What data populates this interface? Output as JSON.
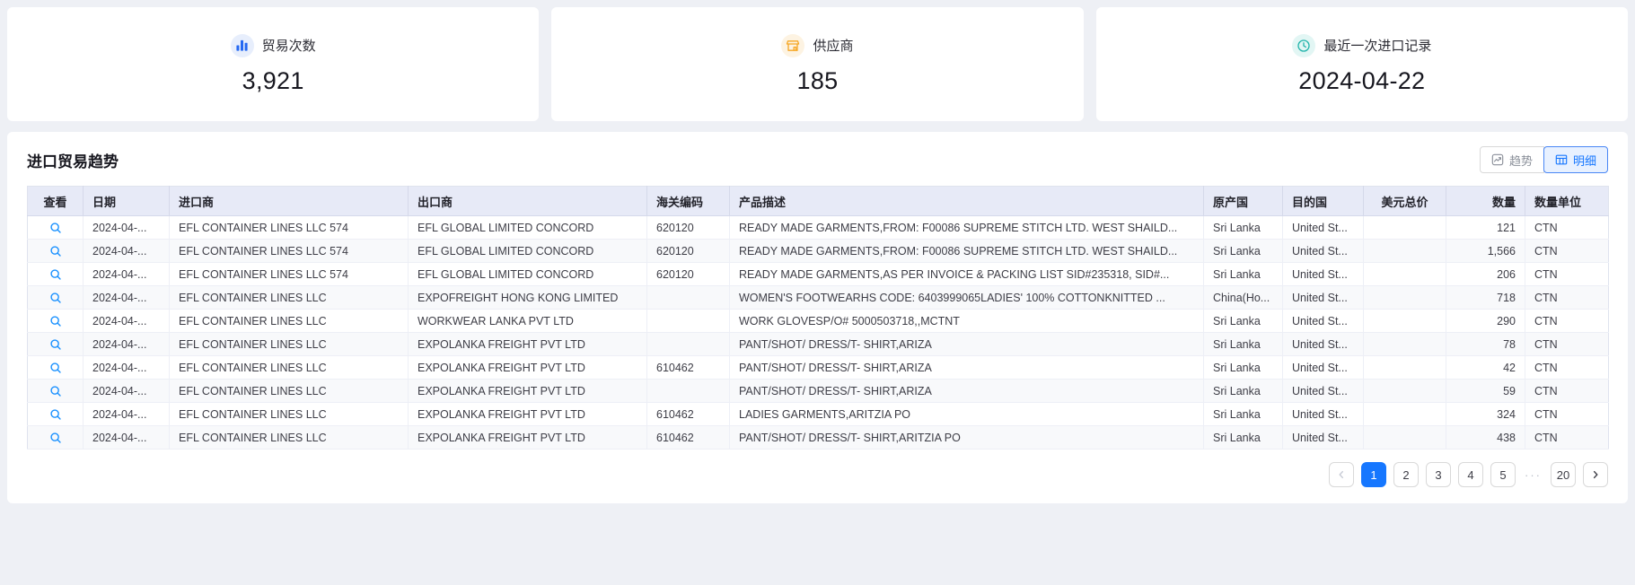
{
  "colors": {
    "page_bg": "#eef0f5",
    "accent_blue": "#1677ff",
    "table_header_bg": "#e7eaf7",
    "magnifier_blue": "#1890ff"
  },
  "cards": [
    {
      "icon": "bar-chart-icon",
      "label": "贸易次数",
      "value": "3,921",
      "icon_color": "#2468f2",
      "icon_bg": "#e7eefc"
    },
    {
      "icon": "shop-icon",
      "label": "供应商",
      "value": "185",
      "icon_color": "#f6a622",
      "icon_bg": "#fdf3e2"
    },
    {
      "icon": "clock-icon",
      "label": "最近一次进口记录",
      "value": "2024-04-22",
      "icon_color": "#1fb3aa",
      "icon_bg": "#e2f6f4"
    }
  ],
  "panel": {
    "title": "进口贸易趋势"
  },
  "toggle": {
    "trend": "趋势",
    "detail": "明细",
    "active": "明细"
  },
  "table": {
    "headers": {
      "view": "查看",
      "date": "日期",
      "importer": "进口商",
      "exporter": "出口商",
      "hs_code": "海关编码",
      "product": "产品描述",
      "origin": "原产国",
      "destination": "目的国",
      "usd_total": "美元总价",
      "quantity": "数量",
      "unit": "数量单位"
    },
    "rows": [
      {
        "date": "2024-04-...",
        "importer": "EFL CONTAINER LINES LLC 574",
        "exporter": "EFL GLOBAL LIMITED CONCORD",
        "hs_code": "620120",
        "product": "READY MADE GARMENTS,FROM: F00086 SUPREME STITCH LTD. WEST SHAILD...",
        "origin": "Sri Lanka",
        "destination": "United St...",
        "usd_total": "",
        "quantity": "121",
        "unit": "CTN"
      },
      {
        "date": "2024-04-...",
        "importer": "EFL CONTAINER LINES LLC 574",
        "exporter": "EFL GLOBAL LIMITED CONCORD",
        "hs_code": "620120",
        "product": "READY MADE GARMENTS,FROM: F00086 SUPREME STITCH LTD. WEST SHAILD...",
        "origin": "Sri Lanka",
        "destination": "United St...",
        "usd_total": "",
        "quantity": "1,566",
        "unit": "CTN"
      },
      {
        "date": "2024-04-...",
        "importer": "EFL CONTAINER LINES LLC 574",
        "exporter": "EFL GLOBAL LIMITED CONCORD",
        "hs_code": "620120",
        "product": "READY MADE GARMENTS,AS PER INVOICE & PACKING LIST SID#235318, SID#...",
        "origin": "Sri Lanka",
        "destination": "United St...",
        "usd_total": "",
        "quantity": "206",
        "unit": "CTN"
      },
      {
        "date": "2024-04-...",
        "importer": "EFL CONTAINER LINES LLC",
        "exporter": "EXPOFREIGHT HONG KONG LIMITED",
        "hs_code": "",
        "product": "WOMEN'S FOOTWEARHS CODE: 6403999065LADIES' 100% COTTONKNITTED ...",
        "origin": "China(Ho...",
        "destination": "United St...",
        "usd_total": "",
        "quantity": "718",
        "unit": "CTN"
      },
      {
        "date": "2024-04-...",
        "importer": "EFL CONTAINER LINES LLC",
        "exporter": "WORKWEAR LANKA PVT LTD",
        "hs_code": "",
        "product": "WORK GLOVESP/O# 5000503718,,MCTNT",
        "origin": "Sri Lanka",
        "destination": "United St...",
        "usd_total": "",
        "quantity": "290",
        "unit": "CTN"
      },
      {
        "date": "2024-04-...",
        "importer": "EFL CONTAINER LINES LLC",
        "exporter": "EXPOLANKA FREIGHT PVT LTD",
        "hs_code": "",
        "product": "PANT/SHOT/ DRESS/T- SHIRT,ARIZA",
        "origin": "Sri Lanka",
        "destination": "United St...",
        "usd_total": "",
        "quantity": "78",
        "unit": "CTN"
      },
      {
        "date": "2024-04-...",
        "importer": "EFL CONTAINER LINES LLC",
        "exporter": "EXPOLANKA FREIGHT PVT LTD",
        "hs_code": "610462",
        "product": "PANT/SHOT/ DRESS/T- SHIRT,ARIZA",
        "origin": "Sri Lanka",
        "destination": "United St...",
        "usd_total": "",
        "quantity": "42",
        "unit": "CTN"
      },
      {
        "date": "2024-04-...",
        "importer": "EFL CONTAINER LINES LLC",
        "exporter": "EXPOLANKA FREIGHT PVT LTD",
        "hs_code": "",
        "product": "PANT/SHOT/ DRESS/T- SHIRT,ARIZA",
        "origin": "Sri Lanka",
        "destination": "United St...",
        "usd_total": "",
        "quantity": "59",
        "unit": "CTN"
      },
      {
        "date": "2024-04-...",
        "importer": "EFL CONTAINER LINES LLC",
        "exporter": "EXPOLANKA FREIGHT PVT LTD",
        "hs_code": "610462",
        "product": "LADIES GARMENTS,ARITZIA PO",
        "origin": "Sri Lanka",
        "destination": "United St...",
        "usd_total": "",
        "quantity": "324",
        "unit": "CTN"
      },
      {
        "date": "2024-04-...",
        "importer": "EFL CONTAINER LINES LLC",
        "exporter": "EXPOLANKA FREIGHT PVT LTD",
        "hs_code": "610462",
        "product": "PANT/SHOT/ DRESS/T- SHIRT,ARITZIA PO",
        "origin": "Sri Lanka",
        "destination": "United St...",
        "usd_total": "",
        "quantity": "438",
        "unit": "CTN"
      }
    ]
  },
  "pagination": {
    "current": "1",
    "pages": [
      "1",
      "2",
      "3",
      "4",
      "5"
    ],
    "ellipsis": "···",
    "last_page": "20"
  }
}
